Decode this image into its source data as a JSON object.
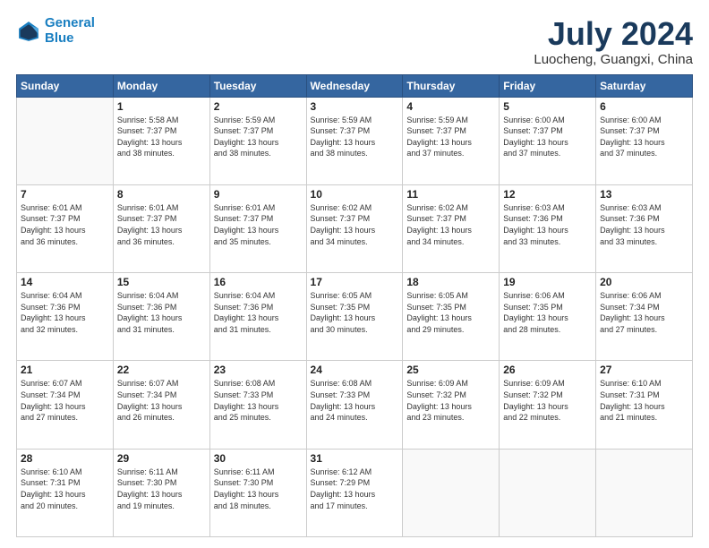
{
  "header": {
    "logo_line1": "General",
    "logo_line2": "Blue",
    "month": "July 2024",
    "location": "Luocheng, Guangxi, China"
  },
  "weekdays": [
    "Sunday",
    "Monday",
    "Tuesday",
    "Wednesday",
    "Thursday",
    "Friday",
    "Saturday"
  ],
  "weeks": [
    [
      {
        "day": "",
        "info": ""
      },
      {
        "day": "1",
        "info": "Sunrise: 5:58 AM\nSunset: 7:37 PM\nDaylight: 13 hours\nand 38 minutes."
      },
      {
        "day": "2",
        "info": "Sunrise: 5:59 AM\nSunset: 7:37 PM\nDaylight: 13 hours\nand 38 minutes."
      },
      {
        "day": "3",
        "info": "Sunrise: 5:59 AM\nSunset: 7:37 PM\nDaylight: 13 hours\nand 38 minutes."
      },
      {
        "day": "4",
        "info": "Sunrise: 5:59 AM\nSunset: 7:37 PM\nDaylight: 13 hours\nand 37 minutes."
      },
      {
        "day": "5",
        "info": "Sunrise: 6:00 AM\nSunset: 7:37 PM\nDaylight: 13 hours\nand 37 minutes."
      },
      {
        "day": "6",
        "info": "Sunrise: 6:00 AM\nSunset: 7:37 PM\nDaylight: 13 hours\nand 37 minutes."
      }
    ],
    [
      {
        "day": "7",
        "info": "Sunrise: 6:01 AM\nSunset: 7:37 PM\nDaylight: 13 hours\nand 36 minutes."
      },
      {
        "day": "8",
        "info": "Sunrise: 6:01 AM\nSunset: 7:37 PM\nDaylight: 13 hours\nand 36 minutes."
      },
      {
        "day": "9",
        "info": "Sunrise: 6:01 AM\nSunset: 7:37 PM\nDaylight: 13 hours\nand 35 minutes."
      },
      {
        "day": "10",
        "info": "Sunrise: 6:02 AM\nSunset: 7:37 PM\nDaylight: 13 hours\nand 34 minutes."
      },
      {
        "day": "11",
        "info": "Sunrise: 6:02 AM\nSunset: 7:37 PM\nDaylight: 13 hours\nand 34 minutes."
      },
      {
        "day": "12",
        "info": "Sunrise: 6:03 AM\nSunset: 7:36 PM\nDaylight: 13 hours\nand 33 minutes."
      },
      {
        "day": "13",
        "info": "Sunrise: 6:03 AM\nSunset: 7:36 PM\nDaylight: 13 hours\nand 33 minutes."
      }
    ],
    [
      {
        "day": "14",
        "info": "Sunrise: 6:04 AM\nSunset: 7:36 PM\nDaylight: 13 hours\nand 32 minutes."
      },
      {
        "day": "15",
        "info": "Sunrise: 6:04 AM\nSunset: 7:36 PM\nDaylight: 13 hours\nand 31 minutes."
      },
      {
        "day": "16",
        "info": "Sunrise: 6:04 AM\nSunset: 7:36 PM\nDaylight: 13 hours\nand 31 minutes."
      },
      {
        "day": "17",
        "info": "Sunrise: 6:05 AM\nSunset: 7:35 PM\nDaylight: 13 hours\nand 30 minutes."
      },
      {
        "day": "18",
        "info": "Sunrise: 6:05 AM\nSunset: 7:35 PM\nDaylight: 13 hours\nand 29 minutes."
      },
      {
        "day": "19",
        "info": "Sunrise: 6:06 AM\nSunset: 7:35 PM\nDaylight: 13 hours\nand 28 minutes."
      },
      {
        "day": "20",
        "info": "Sunrise: 6:06 AM\nSunset: 7:34 PM\nDaylight: 13 hours\nand 27 minutes."
      }
    ],
    [
      {
        "day": "21",
        "info": "Sunrise: 6:07 AM\nSunset: 7:34 PM\nDaylight: 13 hours\nand 27 minutes."
      },
      {
        "day": "22",
        "info": "Sunrise: 6:07 AM\nSunset: 7:34 PM\nDaylight: 13 hours\nand 26 minutes."
      },
      {
        "day": "23",
        "info": "Sunrise: 6:08 AM\nSunset: 7:33 PM\nDaylight: 13 hours\nand 25 minutes."
      },
      {
        "day": "24",
        "info": "Sunrise: 6:08 AM\nSunset: 7:33 PM\nDaylight: 13 hours\nand 24 minutes."
      },
      {
        "day": "25",
        "info": "Sunrise: 6:09 AM\nSunset: 7:32 PM\nDaylight: 13 hours\nand 23 minutes."
      },
      {
        "day": "26",
        "info": "Sunrise: 6:09 AM\nSunset: 7:32 PM\nDaylight: 13 hours\nand 22 minutes."
      },
      {
        "day": "27",
        "info": "Sunrise: 6:10 AM\nSunset: 7:31 PM\nDaylight: 13 hours\nand 21 minutes."
      }
    ],
    [
      {
        "day": "28",
        "info": "Sunrise: 6:10 AM\nSunset: 7:31 PM\nDaylight: 13 hours\nand 20 minutes."
      },
      {
        "day": "29",
        "info": "Sunrise: 6:11 AM\nSunset: 7:30 PM\nDaylight: 13 hours\nand 19 minutes."
      },
      {
        "day": "30",
        "info": "Sunrise: 6:11 AM\nSunset: 7:30 PM\nDaylight: 13 hours\nand 18 minutes."
      },
      {
        "day": "31",
        "info": "Sunrise: 6:12 AM\nSunset: 7:29 PM\nDaylight: 13 hours\nand 17 minutes."
      },
      {
        "day": "",
        "info": ""
      },
      {
        "day": "",
        "info": ""
      },
      {
        "day": "",
        "info": ""
      }
    ]
  ]
}
